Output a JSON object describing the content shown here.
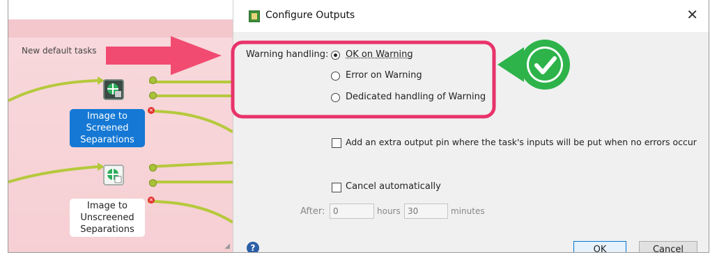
{
  "canvas": {
    "label": "New default tasks",
    "tasks": [
      {
        "label": "Image to Screened Separations",
        "lines": [
          "Image to",
          "Screened",
          "Separations"
        ],
        "selected": true
      },
      {
        "label": "Image to Unscreened Separations",
        "lines": [
          "Image to",
          "Unscreened",
          "Separations"
        ],
        "selected": false
      }
    ]
  },
  "dialog": {
    "title": "Configure Outputs",
    "close_glyph": "✕",
    "warning_handling": {
      "label": "Warning handling:",
      "options": [
        {
          "label": "OK on Warning",
          "selected": true
        },
        {
          "label": "Error on Warning",
          "selected": false
        },
        {
          "label": "Dedicated handling of Warning",
          "selected": false
        }
      ]
    },
    "extra_pin": {
      "label": "Add an extra output pin where the task's inputs will be put when no errors occur",
      "checked": false
    },
    "cancel_auto": {
      "label": "Cancel automatically",
      "checked": false
    },
    "after": {
      "label": "After:",
      "hours_value": "0",
      "hours_unit": "hours",
      "minutes_value": "30",
      "minutes_unit": "minutes"
    },
    "buttons": {
      "ok": "OK",
      "cancel": "Cancel"
    },
    "help_glyph": "?"
  },
  "annotations": {
    "arrow_color": "#f0436b",
    "highlight_color": "#e8336a",
    "check_color": "#2db34a",
    "icons": [
      "arrow-annotation",
      "check-badge-icon",
      "highlight-frame"
    ]
  }
}
